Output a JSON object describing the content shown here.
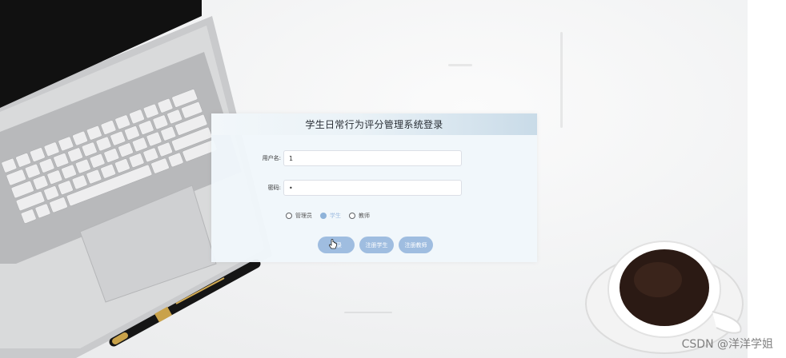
{
  "login": {
    "title": "学生日常行为评分管理系统登录",
    "username_label": "用户名:",
    "username_value": "1",
    "password_label": "密码:",
    "password_value": "•",
    "roles": [
      {
        "label": "管理员",
        "checked": false
      },
      {
        "label": "学生",
        "checked": true
      },
      {
        "label": "教师",
        "checked": false
      }
    ],
    "buttons": {
      "login": "登录",
      "register_student": "注册学生",
      "register_teacher": "注册教师"
    }
  },
  "watermark": "CSDN @洋洋学姐",
  "colors": {
    "accent": "#9fbde0",
    "panel_bg": "#f0f7fb",
    "title_gradient_end": "#c9dbe8"
  }
}
